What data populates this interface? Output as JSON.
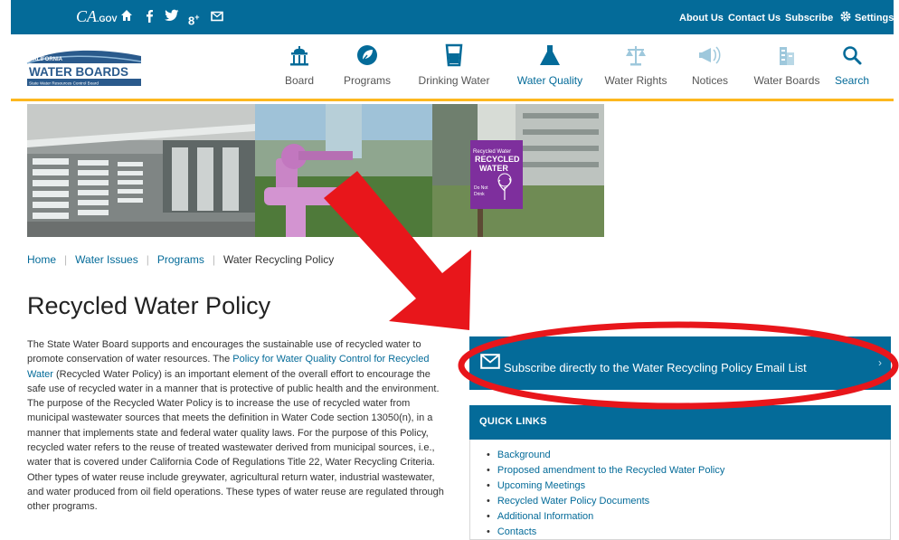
{
  "topbar": {
    "ca_logo_text": "CA",
    "ca_logo_gov": ".GOV",
    "links": [
      "About Us",
      "Contact Us",
      "Subscribe",
      "Settings"
    ]
  },
  "header": {
    "logo_line1": "CALIFORNIA",
    "logo_line2": "WATER BOARDS",
    "logo_line3": "State Water Resources Control Board",
    "nav": [
      {
        "label": "Board",
        "icon": "capitol-icon"
      },
      {
        "label": "Programs",
        "icon": "leaf-icon"
      },
      {
        "label": "Drinking Water",
        "icon": "cup-icon"
      },
      {
        "label": "Water Quality",
        "icon": "flask-icon"
      },
      {
        "label": "Water Rights",
        "icon": "scales-icon"
      },
      {
        "label": "Notices",
        "icon": "megaphone-icon"
      },
      {
        "label": "Water Boards",
        "icon": "buildings-icon"
      },
      {
        "label": "Search",
        "icon": "search-icon"
      }
    ]
  },
  "banner": {
    "sign_line1": "Recycled Water",
    "sign_line2": "RECYCLED",
    "sign_line3": "WATER",
    "sign_line4": "Do Not",
    "sign_line5": "Drink"
  },
  "breadcrumb": {
    "items": [
      "Home",
      "Water Issues",
      "Programs"
    ],
    "current": "Water Recycling Policy"
  },
  "page": {
    "title": "Recycled Water Policy",
    "intro_1": "The State Water Board supports and encourages the sustainable use of recycled water to promote conservation of water resources. The ",
    "intro_link": "Policy for Water Quality Control for Recycled Water",
    "intro_2": " (Recycled Water Policy) is an important element of the overall effort to encourage the safe use of recycled water in a manner that is protective of public health and the environment. The purpose of the Recycled Water Policy is to increase the use of recycled water from municipal wastewater sources that meets the definition in Water Code section 13050(n), in a manner that implements state and federal water quality laws. For the purpose of this Policy, recycled water refers to the reuse of treated wastewater derived from municipal sources, i.e., water that is covered under California Code of Regulations Title 22, Water Recycling Criteria. Other types of water reuse include greywater, agricultural return water, industrial wastewater, and water produced from oil field operations. These types of water reuse are regulated through other programs."
  },
  "subscribe": {
    "label": "Subscribe directly to the Water Recycling Policy Email List",
    "chevron": "›"
  },
  "quick_links": {
    "heading": "QUICK LINKS",
    "items": [
      "Background",
      "Proposed amendment to the Recycled Water Policy",
      "Upcoming Meetings",
      "Recycled Water Policy Documents",
      "Additional Information",
      "Contacts"
    ]
  },
  "colors": {
    "brand_blue": "#046b99",
    "accent_gold": "#fdb81e",
    "annotation_red": "#e8161b"
  }
}
